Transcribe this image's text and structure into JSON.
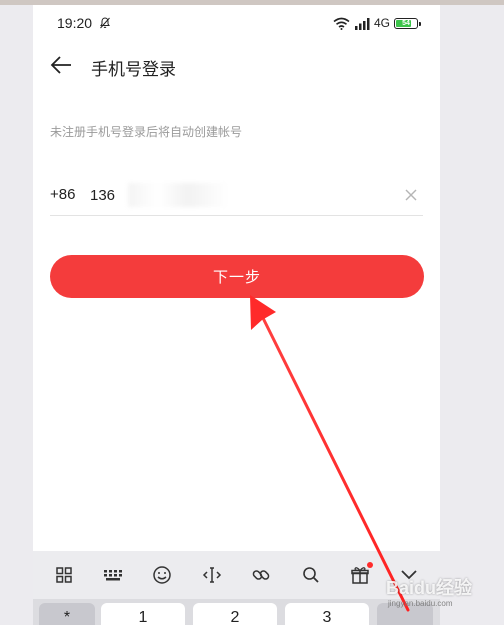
{
  "status_bar": {
    "time": "19:20",
    "network": "4G",
    "battery_level": "54",
    "battery_color": "#3cc44a"
  },
  "header": {
    "title": "手机号登录",
    "back_icon": "arrow-left-icon"
  },
  "form": {
    "hint": "未注册手机号登录后将自动创建帐号",
    "country_code": "+86",
    "phone_value": "136",
    "clear_icon": "close-icon"
  },
  "actions": {
    "next_label": "下一步",
    "next_color": "#f43c3c"
  },
  "keyboard": {
    "toolbar_icons": [
      "grid-icon",
      "keyboard-icon",
      "emoji-icon",
      "cursor-icon",
      "link-icon",
      "search-icon",
      "gift-icon",
      "collapse-icon"
    ],
    "keys": [
      "*",
      "1",
      "2",
      "3"
    ]
  },
  "watermark": {
    "brand": "Baidu经验",
    "url": "jingyan.baidu.com"
  },
  "annotation": {
    "arrow_color": "#ff3b3b"
  }
}
